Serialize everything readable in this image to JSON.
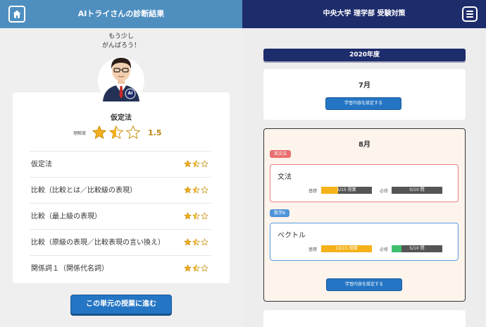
{
  "left_header": {
    "title": "AIトライさんの診断結果",
    "home_icon": "home-icon"
  },
  "speech": {
    "line1": "もう少し",
    "line2": "がんばろう！"
  },
  "avatar": {
    "badge": "AI"
  },
  "unit": {
    "name": "仮定法",
    "rating_label": "理解度",
    "rating_value": "1.5",
    "stars": 1.5
  },
  "topics": [
    {
      "label": "仮定法",
      "stars": 1.5
    },
    {
      "label": "比較（比較とは／比較級の表現）",
      "stars": 1.5
    },
    {
      "label": "比較（最上級の表現）",
      "stars": 1.5
    },
    {
      "label": "比較（原級の表現／比較表現の言い換え）",
      "stars": 1.5
    },
    {
      "label": "関係詞１（関係代名詞）",
      "stars": 1.5
    }
  ],
  "proceed_button": "この単元の授業に進む",
  "right_header": {
    "title": "中央大学 理学部 受験対策",
    "menu_icon": "menu-icon"
  },
  "year": "2020年度",
  "months": {
    "july": {
      "title": "7月",
      "button": "学習内容を設定する"
    },
    "august": {
      "title": "8月",
      "button": "学習内容を設定する",
      "subjects": [
        {
          "tag": "英文法",
          "name": "文法",
          "basic_label": "基礎",
          "basic_text": "5/15 授業",
          "basic_progress": 0.33,
          "required_label": "必修",
          "required_text": "0/10 問",
          "required_progress": 0
        },
        {
          "tag": "数学B",
          "name": "ベクトル",
          "basic_label": "基礎",
          "basic_text": "15/15 授業",
          "basic_progress": 1.0,
          "required_label": "必修",
          "required_text": "5/10 問",
          "required_progress": 0.2
        }
      ]
    }
  },
  "colors": {
    "left_header": "#4e8fc0",
    "right_header": "#1d2c6b",
    "button": "#2475c4",
    "star": "#f2b01e",
    "english_tag": "#e97070",
    "math_tag": "#4f94d8",
    "progress_basic": "#f5b21a",
    "progress_required": "#3fbf6e"
  }
}
